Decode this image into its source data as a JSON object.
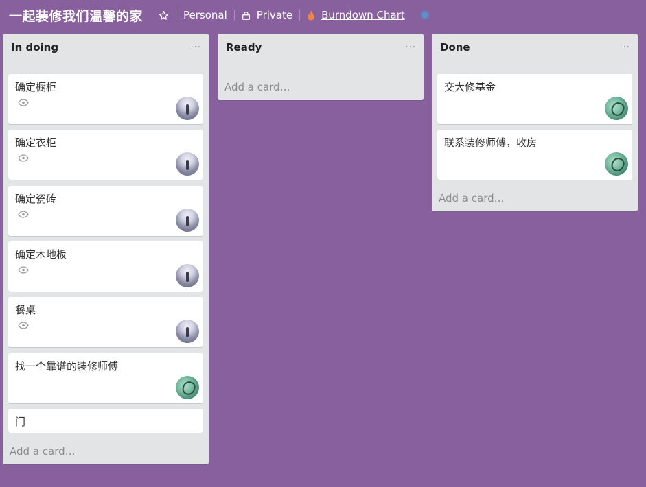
{
  "header": {
    "board_title": "一起装修我们温馨的家",
    "star_icon": "star-outline-icon",
    "personal_label": "Personal",
    "private_label": "Private",
    "private_icon": "lock-icon",
    "burndown_label": "Burndown Chart",
    "burndown_icon": "flame-icon",
    "flame_color": "#f2883e"
  },
  "lists": [
    {
      "title": "In doing",
      "menu": "···",
      "add_card": "Add a card…",
      "cards": [
        {
          "title": "确定橱柜",
          "watched": true,
          "avatar": "grey"
        },
        {
          "title": "确定衣柜",
          "watched": true,
          "avatar": "grey"
        },
        {
          "title": "确定瓷砖",
          "watched": true,
          "avatar": "grey"
        },
        {
          "title": "确定木地板",
          "watched": true,
          "avatar": "grey"
        },
        {
          "title": "餐桌",
          "watched": true,
          "avatar": "grey"
        },
        {
          "title": "找一个靠谱的装修师傅",
          "watched": false,
          "avatar": "green"
        },
        {
          "title": "门",
          "watched": false,
          "avatar": ""
        }
      ]
    },
    {
      "title": "Ready",
      "menu": "···",
      "add_card": "Add a card…",
      "cards": []
    },
    {
      "title": "Done",
      "menu": "···",
      "add_card": "Add a card…",
      "cards": [
        {
          "title": "交大修基金",
          "watched": false,
          "avatar": "green"
        },
        {
          "title": "联系装修师傅，收房",
          "watched": false,
          "avatar": "green"
        }
      ]
    }
  ],
  "colors": {
    "board_background": "#89609e",
    "list_background": "#e2e4e6",
    "card_background": "#ffffff"
  }
}
